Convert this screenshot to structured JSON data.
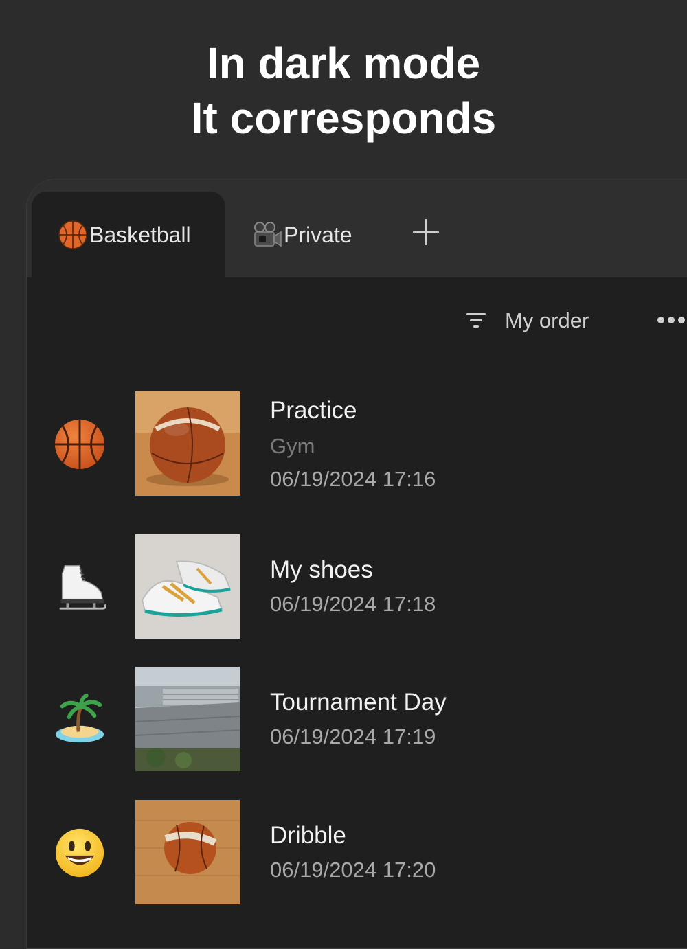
{
  "headline": {
    "line1": "In dark mode",
    "line2": "It corresponds"
  },
  "tabs": [
    {
      "label": "Basketball",
      "icon": "basketball-icon",
      "active": true
    },
    {
      "label": "Private",
      "icon": "movie-camera-icon",
      "active": false
    }
  ],
  "toolbar": {
    "sort_label": "My order"
  },
  "items": [
    {
      "title": "Practice",
      "subtitle": "Gym",
      "date": "06/19/2024 17:16",
      "emoji": "basketball-icon"
    },
    {
      "title": "My shoes",
      "date": "06/19/2024 17:18",
      "emoji": "ice-skate-icon"
    },
    {
      "title": "Tournament Day",
      "date": "06/19/2024 17:19",
      "emoji": "desert-island-icon"
    },
    {
      "title": "Dribble",
      "date": "06/19/2024 17:20",
      "emoji": "smiley-icon"
    }
  ]
}
